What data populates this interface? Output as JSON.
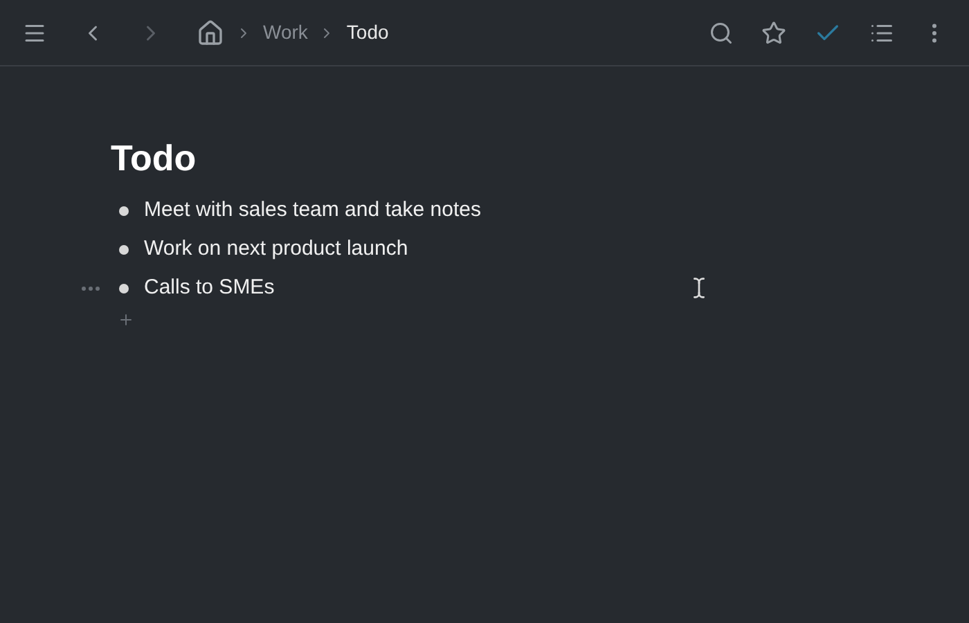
{
  "breadcrumbs": [
    {
      "label": "Work",
      "current": false
    },
    {
      "label": "Todo",
      "current": true
    }
  ],
  "page": {
    "title": "Todo",
    "items": [
      {
        "text": "Meet with sales team and take notes",
        "hovered": false
      },
      {
        "text": "Work on next product launch",
        "hovered": false
      },
      {
        "text": "Calls to SMEs",
        "hovered": true
      }
    ]
  }
}
